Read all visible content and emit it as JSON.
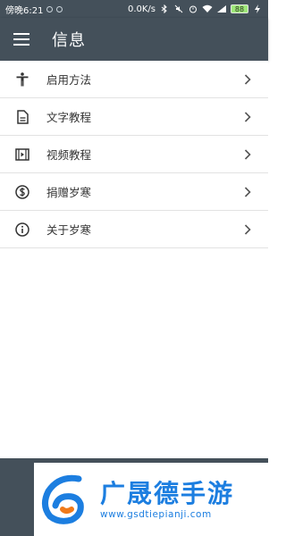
{
  "status_bar": {
    "time": "傍晚6:21",
    "network_speed": "0.0K/s",
    "battery": "88"
  },
  "app_bar": {
    "title": "信息"
  },
  "list": {
    "items": [
      {
        "label": "启用方法",
        "icon": "accessibility-icon"
      },
      {
        "label": "文字教程",
        "icon": "document-icon"
      },
      {
        "label": "视频教程",
        "icon": "video-icon"
      },
      {
        "label": "捐赠岁寒",
        "icon": "dollar-icon"
      },
      {
        "label": "关于岁寒",
        "icon": "info-icon"
      }
    ]
  },
  "watermark": {
    "brand": "广晟德手游",
    "url": "www.gsdtiepianji.com"
  },
  "colors": {
    "primary": "#44505a",
    "accent": "#1c7ee0"
  }
}
